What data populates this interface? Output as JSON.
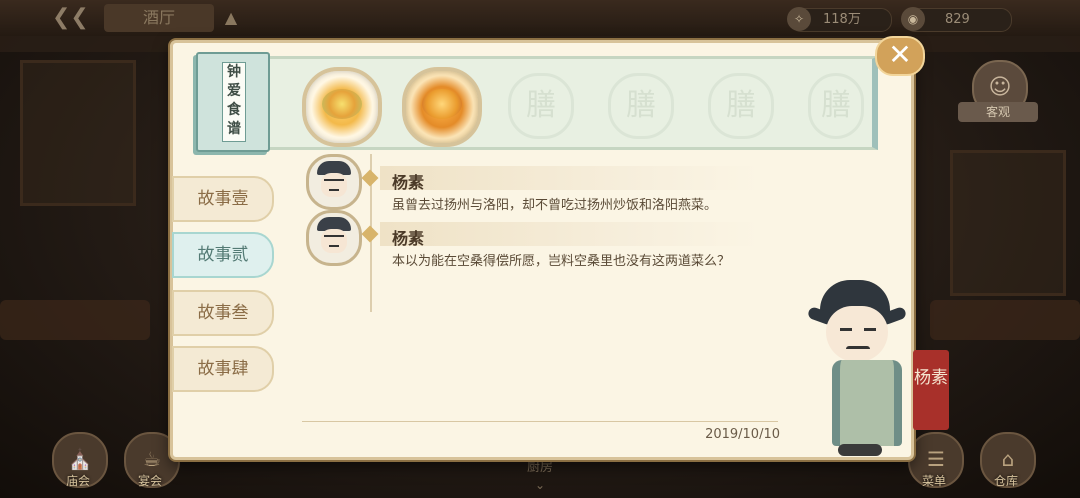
{
  "topbar": {
    "back_label": "‹",
    "location": "酒厅",
    "coins": "118万",
    "gems": "829"
  },
  "guest": {
    "label": "客观"
  },
  "dialog": {
    "recipe_book_title": "钟爱食谱",
    "strip_glyph": "膳",
    "tabs": [
      "故事壹",
      "故事贰",
      "故事叁",
      "故事肆"
    ],
    "active_tab": 1,
    "messages": [
      {
        "speaker": "杨素",
        "text": "虽曾去过扬州与洛阳，却不曾吃过扬州炒饭和洛阳燕菜。"
      },
      {
        "speaker": "杨素",
        "text": "本以为能在空桑得偿所愿，岂料空桑里也没有这两道菜么？"
      }
    ],
    "date": "2019/10/10",
    "character_name": "杨素",
    "close_label": "✕"
  },
  "bottom": {
    "left1": "庙会",
    "left2": "宴会",
    "center": "厨房",
    "right1": "菜单",
    "right2": "仓库"
  },
  "colors": {
    "panel": "#fbf5e4",
    "accent_teal": "#a8d6d0",
    "name_tag": "#a8302a",
    "close_button": "#d2a25a"
  }
}
